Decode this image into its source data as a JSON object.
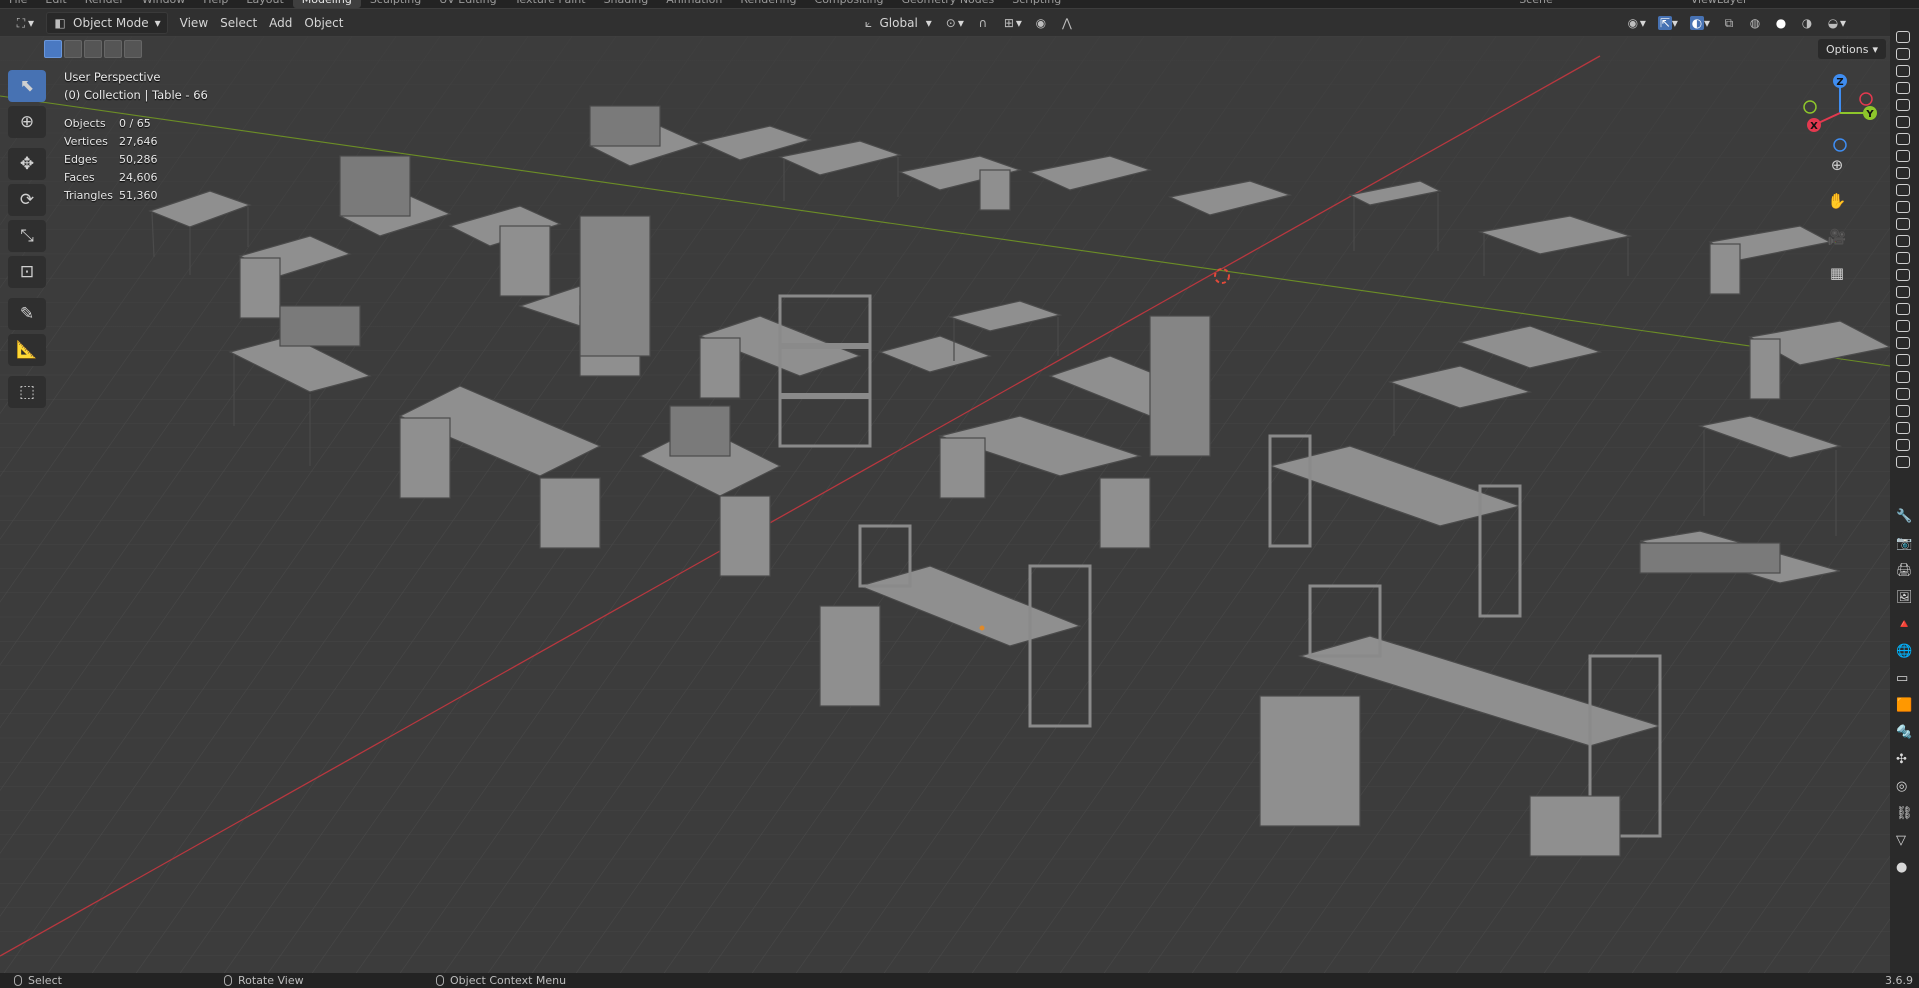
{
  "topbar": {
    "menus": [
      "File",
      "Edit",
      "Render",
      "Window",
      "Help"
    ],
    "workspaces": [
      "Layout",
      "Modeling",
      "Sculpting",
      "UV Editing",
      "Texture Paint",
      "Shading",
      "Animation",
      "Rendering",
      "Compositing",
      "Geometry Nodes",
      "Scripting"
    ],
    "active_workspace": "Modeling",
    "scene": "Scene",
    "view_layer": "ViewLayer"
  },
  "header": {
    "mode": "Object Mode",
    "menus": [
      "View",
      "Select",
      "Add",
      "Object"
    ],
    "transform_orientation": "Global",
    "options_label": "Options"
  },
  "overlay": {
    "view_name": "User Perspective",
    "collection": "(0) Collection | Table - 66"
  },
  "stats": [
    {
      "label": "Objects",
      "value": "0 / 65"
    },
    {
      "label": "Vertices",
      "value": "27,646"
    },
    {
      "label": "Edges",
      "value": "50,286"
    },
    {
      "label": "Faces",
      "value": "24,606"
    },
    {
      "label": "Triangles",
      "value": "51,360"
    }
  ],
  "gizmo": {
    "x_label": "X",
    "y_label": "Y",
    "z_label": "Z",
    "x_color": "#e3394f",
    "y_color": "#8ec62b",
    "z_color": "#3f8df1"
  },
  "statusbar": {
    "select": "Select",
    "rotate": "Rotate View",
    "context_menu": "Object Context Menu",
    "version": "3.6.9"
  },
  "colors": {
    "accent": "#4772b3",
    "viewport_bg": "#3c3c3c",
    "x_axis": "#b8373f",
    "y_axis": "#6c8e25"
  }
}
